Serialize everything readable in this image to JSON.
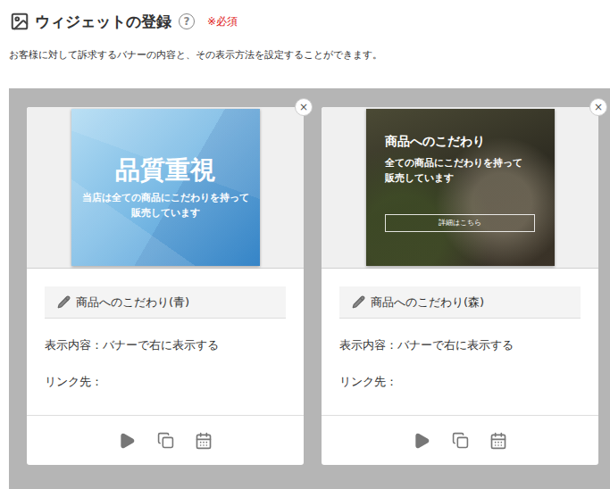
{
  "header": {
    "title": "ウィジェットの登録",
    "help": "?",
    "required": "※必須"
  },
  "description": "お客様に対して訴求するバナーの内容と、その表示方法を設定することができます。",
  "widgets": [
    {
      "name": "商品へのこだわり(青)",
      "display": "表示内容：バナーで右に表示する",
      "link": "リンク先：",
      "close": "×",
      "banner": {
        "kind": "blue",
        "heading": "品質重視",
        "lines": [
          "当店は全ての商品にこだわりを持って",
          "販売しています"
        ],
        "button": ""
      }
    },
    {
      "name": "商品へのこだわり(森)",
      "display": "表示内容：バナーで右に表示する",
      "link": "リンク先：",
      "close": "×",
      "banner": {
        "kind": "photo",
        "heading": "商品へのこだわり",
        "lines": [
          "全ての商品にこだわりを持って",
          "販売しています"
        ],
        "button": "詳細はこちら"
      }
    }
  ]
}
